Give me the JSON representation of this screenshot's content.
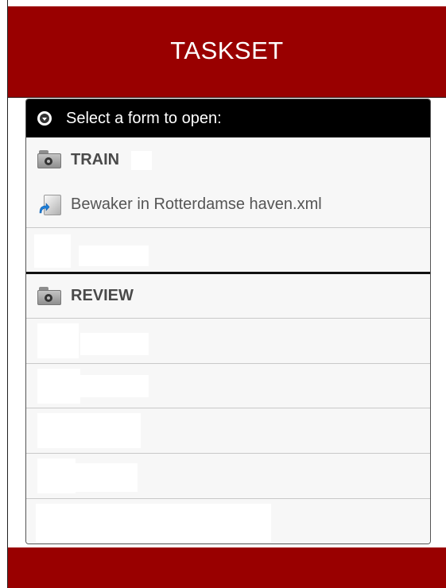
{
  "app": {
    "title": "TASKSET"
  },
  "panel": {
    "header": {
      "text": "Select a form to open:",
      "icon": "chevron-down-circle-icon"
    },
    "groups": [
      {
        "label": "TRAIN",
        "icon": "folder-gear-icon",
        "items": [
          {
            "label": "Bewaker in Rotterdamse haven.xml",
            "icon": "form-open-icon"
          }
        ]
      },
      {
        "label": "REVIEW",
        "icon": "folder-gear-icon",
        "items": []
      }
    ]
  },
  "colors": {
    "brand": "#990000",
    "header_bg": "#000000",
    "panel_bg": "#f7f7f7"
  }
}
